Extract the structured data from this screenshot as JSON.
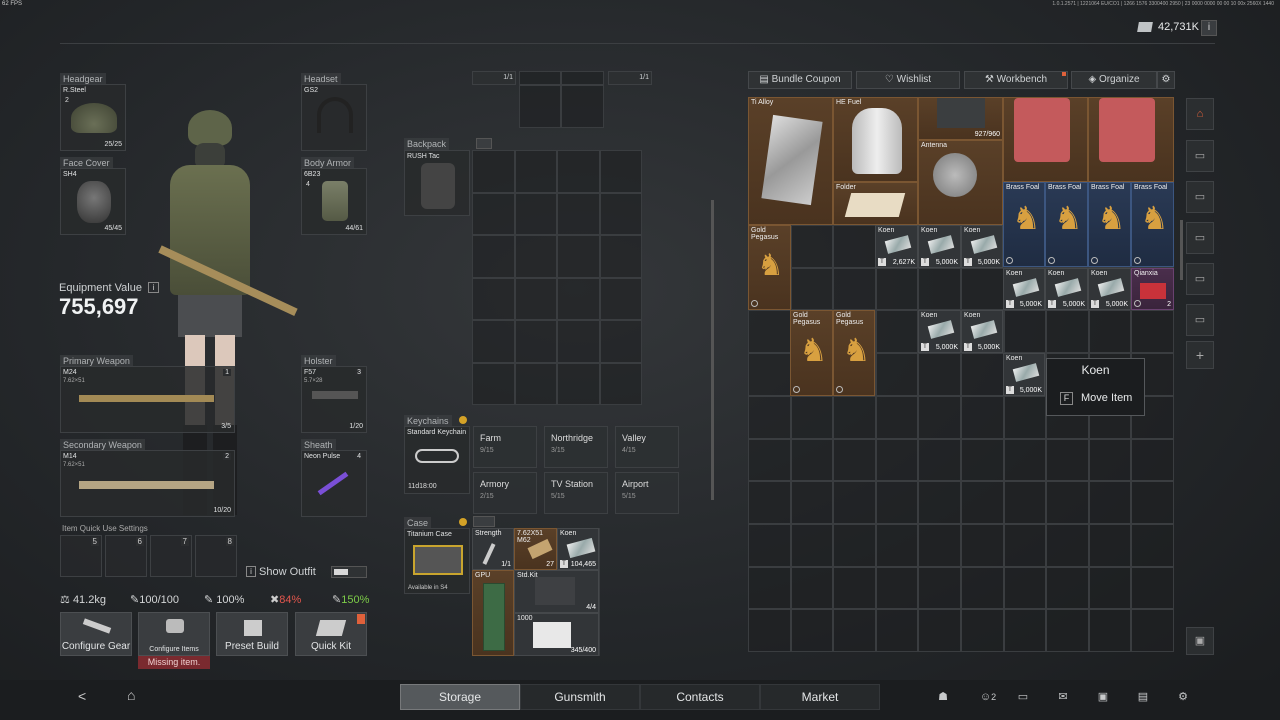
{
  "hud": {
    "fps": "62 FPS",
    "debug": "1.0.1.2571 | 1221064 EU/CO1 | 1266 1576 3300400 2950 | 23 0000 0000 00 00 10 00x 2560X 1440"
  },
  "currency": {
    "amount": "42,731K"
  },
  "character": {
    "equipment_value_label": "Equipment Value",
    "equipment_value": "755,697",
    "show_outfit_label": "Show Outfit",
    "quick_use_label": "Item Quick Use Settings",
    "quick_slots": [
      "5",
      "6",
      "7",
      "8"
    ]
  },
  "slots": {
    "headgear": {
      "label": "Headgear",
      "name": "R.Steel",
      "level": "2",
      "durability": "25/25"
    },
    "face_cover": {
      "label": "Face Cover",
      "name": "SH4",
      "durability": "45/45"
    },
    "headset": {
      "label": "Headset",
      "name": "GS2"
    },
    "body_armor": {
      "label": "Body Armor",
      "name": "6B23",
      "level": "4",
      "durability": "44/61"
    },
    "primary": {
      "label": "Primary Weapon",
      "name": "M24",
      "caliber": "7.62×51",
      "slot": "1",
      "ammo": "3/5"
    },
    "secondary": {
      "label": "Secondary Weapon",
      "name": "M14",
      "caliber": "7.62×51",
      "slot": "2",
      "ammo": "10/20"
    },
    "holster": {
      "label": "Holster",
      "name": "F57",
      "caliber": "5.7×28",
      "slot": "3",
      "ammo": "1/20"
    },
    "sheath": {
      "label": "Sheath",
      "name": "Neon Pulse",
      "slot": "4"
    }
  },
  "stats": {
    "weight": "41.2kg",
    "stamina": "100/100",
    "stat2": "100%",
    "stat3": "84%",
    "stat4": "150%"
  },
  "actions": {
    "configure_gear": "Configure Gear",
    "configure_items": "Configure Items",
    "missing": "Missing item.",
    "preset_build": "Preset Build",
    "quick_kit": "Quick Kit"
  },
  "containers": {
    "top_left_count": "1/1",
    "top_right_count": "1/1",
    "backpack_label": "Backpack",
    "backpack_name": "RUSH Tac",
    "keychains_label": "Keychains",
    "keychain_name": "Standard Keychain",
    "keychain_timer": "11d18:00",
    "case_label": "Case",
    "case_name": "Titanium Case",
    "case_note": "Available in S4"
  },
  "keys": [
    {
      "name": "Farm",
      "count": "9/15"
    },
    {
      "name": "Northridge",
      "count": "3/15"
    },
    {
      "name": "Valley",
      "count": "4/15"
    },
    {
      "name": "Armory",
      "count": "2/15"
    },
    {
      "name": "TV Station",
      "count": "5/15"
    },
    {
      "name": "Airport",
      "count": "5/15"
    }
  ],
  "case_items": {
    "strength": {
      "name": "Strength",
      "count": "1/1"
    },
    "ammo": {
      "name": "7.62X51 M62",
      "count": "27"
    },
    "koen": {
      "name": "Koen",
      "count": "104,465"
    },
    "gpu": {
      "name": "GPU"
    },
    "stdkit": {
      "name": "Std.Kit",
      "count": "4/4"
    },
    "medkit": {
      "name": "1000",
      "count": "345/400"
    }
  },
  "storage_tabs": [
    "Bundle Coupon",
    "Wishlist",
    "Workbench",
    "Organize"
  ],
  "storage_items": {
    "ti_alloy": "Ti Alloy",
    "he_fuel": "HE Fuel",
    "pouch_count": "927/960",
    "antenna": "Antenna",
    "folder": "Folder",
    "gold_pegasus": "Gold Pegasus",
    "brass_foal": "Brass Foal",
    "koen": "Koen",
    "koen_val_a": "2,627K",
    "koen_val": "5,000K",
    "qianxia": "Qianxia",
    "qianxia_count": "2"
  },
  "tooltip": {
    "title": "Koen",
    "key": "F",
    "action": "Move Item"
  },
  "nav": {
    "storage": "Storage",
    "gunsmith": "Gunsmith",
    "contacts": "Contacts",
    "market": "Market",
    "badge": "2"
  }
}
